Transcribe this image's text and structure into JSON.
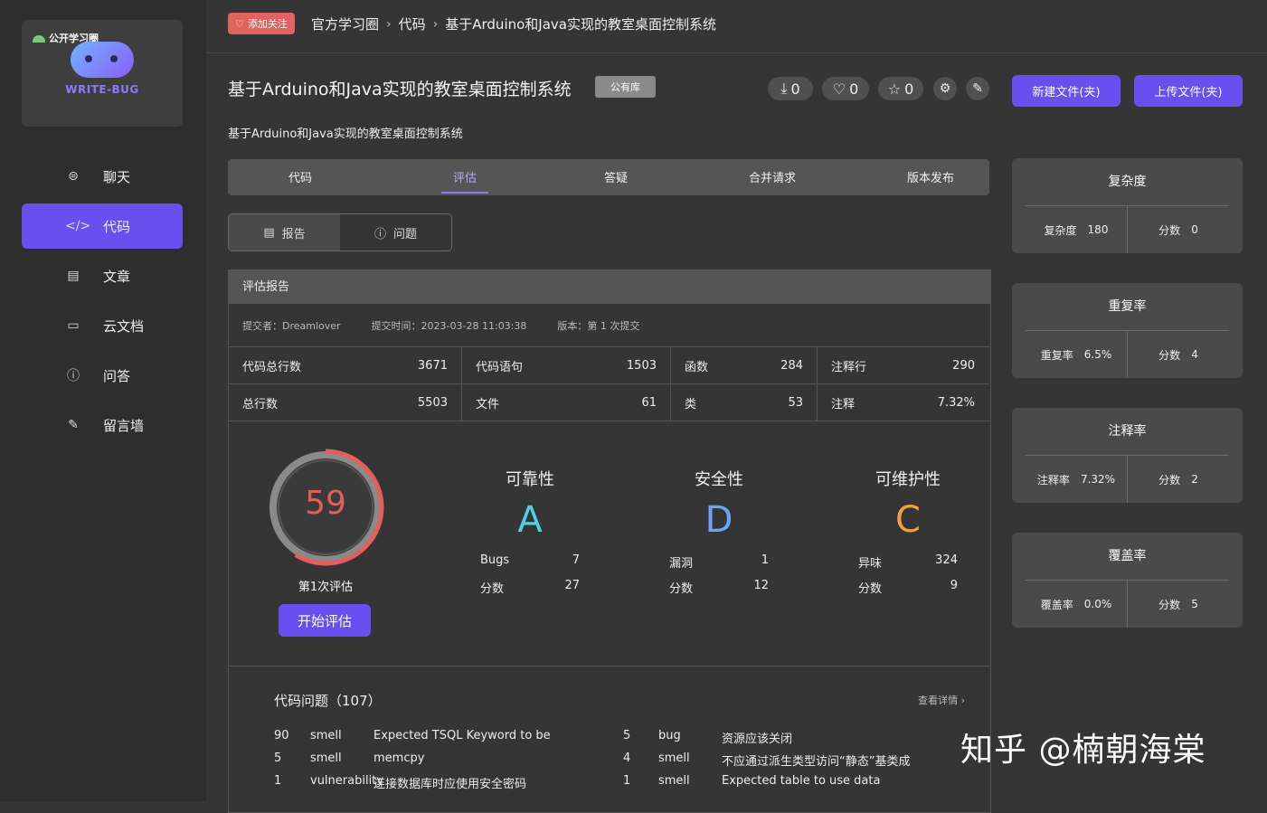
{
  "sidebar": {
    "logo_label": "公开学习圈",
    "logo_text": "WRITE-BUG",
    "items": [
      {
        "label": "聊天",
        "icon": "chat-icon",
        "active": false
      },
      {
        "label": "代码",
        "icon": "code-icon",
        "active": true
      },
      {
        "label": "文章",
        "icon": "article-icon",
        "active": false
      },
      {
        "label": "云文档",
        "icon": "folder-icon",
        "active": false
      },
      {
        "label": "问答",
        "icon": "question-icon",
        "active": false
      },
      {
        "label": "留言墙",
        "icon": "edit-icon",
        "active": false
      }
    ]
  },
  "topbar": {
    "follow_label": "添加关注",
    "breadcrumb": [
      "官方学习圈",
      "代码",
      "基于Arduino和Java实现的教室桌面控制系统"
    ]
  },
  "project": {
    "title": "基于Arduino和Java实现的教室桌面控制系统",
    "badge": "公有库",
    "description": "基于Arduino和Java实现的教室桌面控制系统",
    "downloads": "0",
    "likes": "0",
    "stars": "0",
    "new_file_label": "新建文件(夹)",
    "upload_label": "上传文件(夹)"
  },
  "tabs": [
    "代码",
    "评估",
    "答疑",
    "合并请求",
    "版本发布"
  ],
  "subtabs": [
    "报告",
    "问题"
  ],
  "report": {
    "title": "评估报告",
    "submitter": "提交者：Dreamlover",
    "submit_time": "提交时间：2023-03-28 11:03:38",
    "version": "版本：第 1 次提交",
    "stats": [
      {
        "label": "代码总行数",
        "value": "3671"
      },
      {
        "label": "代码语句",
        "value": "1503"
      },
      {
        "label": "函数",
        "value": "284"
      },
      {
        "label": "注释行",
        "value": "290"
      },
      {
        "label": "总行数",
        "value": "5503"
      },
      {
        "label": "文件",
        "value": "61"
      },
      {
        "label": "类",
        "value": "53"
      },
      {
        "label": "注释",
        "value": "7.32%"
      }
    ],
    "score": "59",
    "score_fraction": 0.59,
    "score_label": "第1次评估",
    "start_label": "开始评估",
    "metrics": [
      {
        "title": "可靠性",
        "grade": "A",
        "color": "#4fd1e0",
        "rows": [
          {
            "k": "Bugs",
            "v": "7"
          },
          {
            "k": "分数",
            "v": "27"
          }
        ]
      },
      {
        "title": "安全性",
        "grade": "D",
        "color": "#6aa6f5",
        "rows": [
          {
            "k": "漏洞",
            "v": "1"
          },
          {
            "k": "分数",
            "v": "12"
          }
        ]
      },
      {
        "title": "可维护性",
        "grade": "C",
        "color": "#f0a040",
        "rows": [
          {
            "k": "异味",
            "v": "324"
          },
          {
            "k": "分数",
            "v": "9"
          }
        ]
      }
    ],
    "issues_title": "代码问题（107）",
    "issues_more": "查看详情",
    "issues_left": [
      {
        "count": "90",
        "type": "smell",
        "desc": "Expected TSQL Keyword to be"
      },
      {
        "count": "5",
        "type": "smell",
        "desc": "memcpy"
      },
      {
        "count": "1",
        "type": "vulnerability",
        "desc": "连接数据库时应使用安全密码"
      }
    ],
    "issues_right": [
      {
        "count": "5",
        "type": "bug",
        "desc": "资源应该关闭"
      },
      {
        "count": "4",
        "type": "smell",
        "desc": "不应通过派生类型访问“静态”基类成"
      },
      {
        "count": "1",
        "type": "smell",
        "desc": "Expected table to use data"
      }
    ]
  },
  "side_cards": [
    {
      "title": "复杂度",
      "k1": "复杂度",
      "v1": "180",
      "k2": "分数",
      "v2": "0"
    },
    {
      "title": "重复率",
      "k1": "重复率",
      "v1": "6.5%",
      "k2": "分数",
      "v2": "4"
    },
    {
      "title": "注释率",
      "k1": "注释率",
      "v1": "7.32%",
      "k2": "分数",
      "v2": "2"
    },
    {
      "title": "覆盖率",
      "k1": "覆盖率",
      "v1": "0.0%",
      "k2": "分数",
      "v2": "5"
    }
  ],
  "watermark": "知乎 @楠朝海棠"
}
